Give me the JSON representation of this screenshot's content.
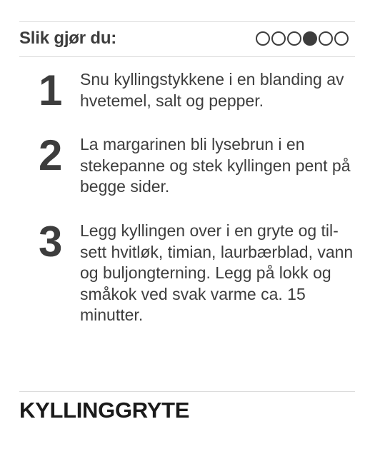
{
  "header": {
    "title": "Slik gjør du:",
    "progress": {
      "total": 6,
      "current": 4
    }
  },
  "steps": [
    {
      "number": "1",
      "text": "Snu kyllingstykkene i en blanding av hvetemel, salt og pepper."
    },
    {
      "number": "2",
      "text": "La margarinen bli lysebrun i en stekepanne og stek kyllingen pent på begge sider."
    },
    {
      "number": "3",
      "text": "Legg kyllingen over i en gryte og til-sett hvitløk, timian, laurbærblad, vann og buljongterning. Legg på lokk og småkok ved svak varme ca. 15 minutter."
    }
  ],
  "recipe": {
    "title": "KYLLINGGRYTE"
  },
  "colors": {
    "text": "#3d3d3d",
    "rule": "#dcdcdc"
  }
}
